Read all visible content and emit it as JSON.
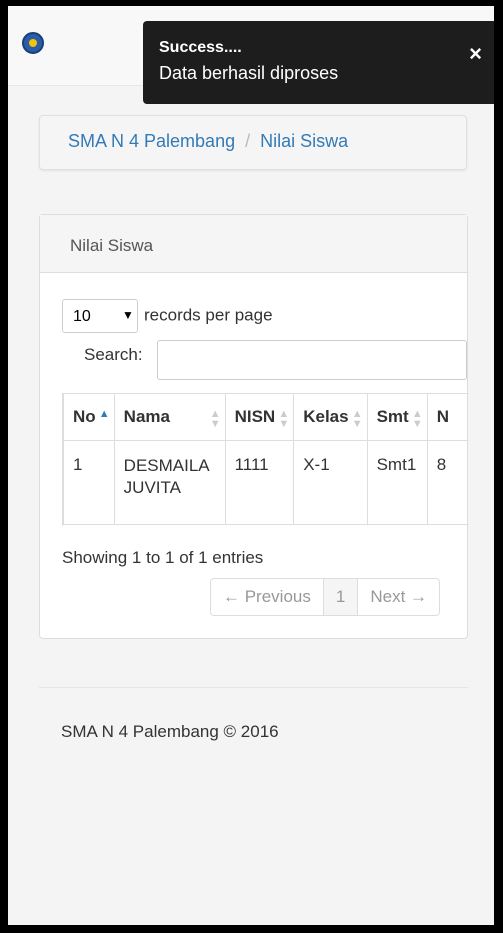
{
  "toast": {
    "title": "Success....",
    "message": "Data berhasil diproses",
    "close": "×"
  },
  "breadcrumb": {
    "home": "SMA N 4 Palembang",
    "separator": "/",
    "current": "Nilai Siswa"
  },
  "panel": {
    "title": "Nilai Siswa",
    "length_value": "10",
    "length_suffix": "records per page",
    "search_label": "Search:",
    "search_value": ""
  },
  "table": {
    "headers": [
      "No",
      "Nama",
      "NISN",
      "Kelas",
      "Smt",
      "N"
    ],
    "rows": [
      [
        "1",
        "DESMAILA JUVITA",
        "1111",
        "X-1",
        "Smt1",
        "8"
      ]
    ]
  },
  "info": "Showing 1 to 1 of 1 entries",
  "pager": {
    "previous": "← Previous",
    "page": "1",
    "next": "Next →"
  },
  "footer": "SMA N 4 Palembang © 2016",
  "colors": {
    "link": "#337ab7",
    "toast_bg": "#1d1d1d"
  }
}
